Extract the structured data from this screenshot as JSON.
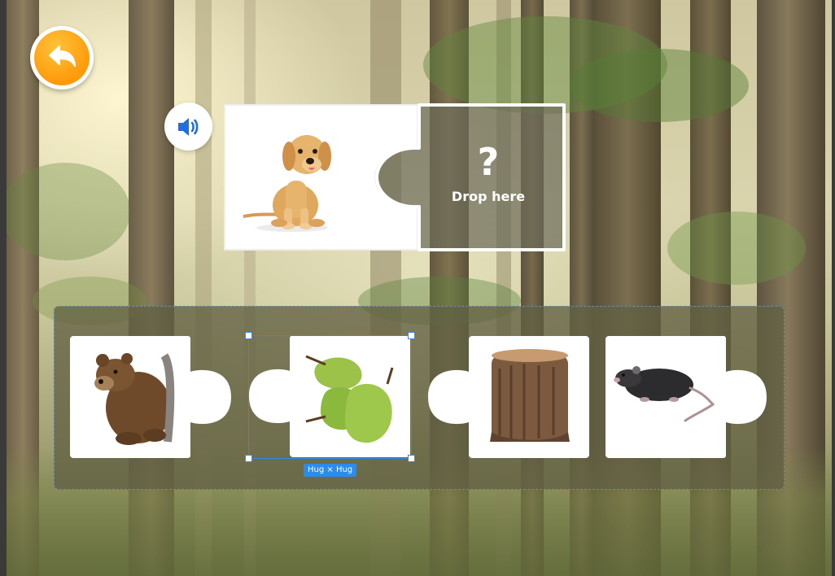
{
  "header": {
    "back_icon": "back-arrow-icon",
    "speaker_icon": "speaker-icon"
  },
  "target": {
    "image": "puppy",
    "drop_symbol": "?",
    "drop_label": "Drop here"
  },
  "tray": {
    "pieces": [
      {
        "name": "bear",
        "image": "bear"
      },
      {
        "name": "pears",
        "image": "pears"
      },
      {
        "name": "tree-stump",
        "image": "tree stump"
      },
      {
        "name": "rat",
        "image": "rat"
      }
    ]
  },
  "selection": {
    "badge": "Hug × Hug"
  },
  "colors": {
    "accent_orange": "#ff9a0a",
    "speaker_blue": "#1f6fe0",
    "selection_blue": "#2b8cf0"
  }
}
